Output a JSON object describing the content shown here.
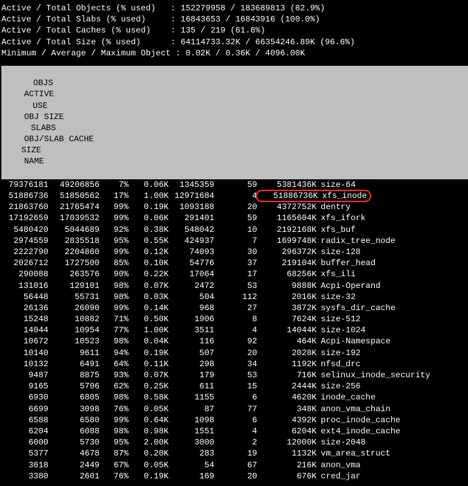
{
  "summary": [
    {
      "label": "Active / Total Objects (% used)   ",
      "sep": ": ",
      "value": "152279958 / 183689813 (82.9%)"
    },
    {
      "label": "Active / Total Slabs (% used)     ",
      "sep": ": ",
      "value": "16843653 / 16843916 (100.0%)"
    },
    {
      "label": "Active / Total Caches (% used)    ",
      "sep": ": ",
      "value": "135 / 219 (61.6%)"
    },
    {
      "label": "Active / Total Size (% used)      ",
      "sep": ": ",
      "value": "64114733.32K / 66354246.89K (96.6%)"
    },
    {
      "label": "Minimum / Average / Maximum Object",
      "sep": " : ",
      "value": "0.02K / 0.36K / 4096.00K"
    }
  ],
  "headers": {
    "objs": "OBJS",
    "active": "ACTIVE",
    "use": "USE",
    "objsz": "OBJ SIZE",
    "slabs": "SLABS",
    "objslb": "OBJ/SLAB CACHE",
    "cache": "SIZE",
    "name": "NAME"
  },
  "rows": [
    {
      "objs": "79376181",
      "active": "49206856",
      "use": "7%",
      "objsz": "0.06K",
      "slabs": "1345359",
      "objslb": "59",
      "cache": "5381436K",
      "name": "size-64"
    },
    {
      "objs": "51886736",
      "active": "51850562",
      "use": "17%",
      "objsz": "1.00K",
      "slabs": "12971684",
      "objslb": "4",
      "cache": "51886736K",
      "name": "xfs_inode",
      "hl": true
    },
    {
      "objs": "21863760",
      "active": "21765474",
      "use": "99%",
      "objsz": "0.19K",
      "slabs": "1093188",
      "objslb": "20",
      "cache": "4372752K",
      "name": "dentry"
    },
    {
      "objs": "17192659",
      "active": "17039532",
      "use": "99%",
      "objsz": "0.06K",
      "slabs": "291401",
      "objslb": "59",
      "cache": "1165604K",
      "name": "xfs_ifork"
    },
    {
      "objs": "5480420",
      "active": "5044689",
      "use": "92%",
      "objsz": "0.38K",
      "slabs": "548042",
      "objslb": "10",
      "cache": "2192168K",
      "name": "xfs_buf"
    },
    {
      "objs": "2974559",
      "active": "2835518",
      "use": "95%",
      "objsz": "0.55K",
      "slabs": "424937",
      "objslb": "7",
      "cache": "1699748K",
      "name": "radix_tree_node"
    },
    {
      "objs": "2222790",
      "active": "2204860",
      "use": "99%",
      "objsz": "0.12K",
      "slabs": "74093",
      "objslb": "30",
      "cache": "296372K",
      "name": "size-128"
    },
    {
      "objs": "2026712",
      "active": "1727500",
      "use": "85%",
      "objsz": "0.10K",
      "slabs": "54776",
      "objslb": "37",
      "cache": "219104K",
      "name": "buffer_head"
    },
    {
      "objs": "290088",
      "active": "263576",
      "use": "90%",
      "objsz": "0.22K",
      "slabs": "17064",
      "objslb": "17",
      "cache": "68256K",
      "name": "xfs_ili"
    },
    {
      "objs": "131016",
      "active": "129101",
      "use": "98%",
      "objsz": "0.07K",
      "slabs": "2472",
      "objslb": "53",
      "cache": "9888K",
      "name": "Acpi-Operand"
    },
    {
      "objs": "56448",
      "active": "55731",
      "use": "98%",
      "objsz": "0.03K",
      "slabs": "504",
      "objslb": "112",
      "cache": "2016K",
      "name": "size-32"
    },
    {
      "objs": "26136",
      "active": "26090",
      "use": "99%",
      "objsz": "0.14K",
      "slabs": "968",
      "objslb": "27",
      "cache": "3872K",
      "name": "sysfs_dir_cache"
    },
    {
      "objs": "15248",
      "active": "10882",
      "use": "71%",
      "objsz": "0.50K",
      "slabs": "1906",
      "objslb": "8",
      "cache": "7624K",
      "name": "size-512"
    },
    {
      "objs": "14044",
      "active": "10954",
      "use": "77%",
      "objsz": "1.00K",
      "slabs": "3511",
      "objslb": "4",
      "cache": "14044K",
      "name": "size-1024"
    },
    {
      "objs": "10672",
      "active": "10523",
      "use": "98%",
      "objsz": "0.04K",
      "slabs": "116",
      "objslb": "92",
      "cache": "464K",
      "name": "Acpi-Namespace"
    },
    {
      "objs": "10140",
      "active": "9611",
      "use": "94%",
      "objsz": "0.19K",
      "slabs": "507",
      "objslb": "20",
      "cache": "2028K",
      "name": "size-192"
    },
    {
      "objs": "10132",
      "active": "6491",
      "use": "64%",
      "objsz": "0.11K",
      "slabs": "298",
      "objslb": "34",
      "cache": "1192K",
      "name": "nfsd_drc"
    },
    {
      "objs": "9487",
      "active": "8875",
      "use": "93%",
      "objsz": "0.07K",
      "slabs": "179",
      "objslb": "53",
      "cache": "716K",
      "name": "selinux_inode_security"
    },
    {
      "objs": "9165",
      "active": "5706",
      "use": "62%",
      "objsz": "0.25K",
      "slabs": "611",
      "objslb": "15",
      "cache": "2444K",
      "name": "size-256"
    },
    {
      "objs": "6930",
      "active": "6805",
      "use": "98%",
      "objsz": "0.58K",
      "slabs": "1155",
      "objslb": "6",
      "cache": "4620K",
      "name": "inode_cache"
    },
    {
      "objs": "6699",
      "active": "3098",
      "use": "76%",
      "objsz": "0.05K",
      "slabs": "87",
      "objslb": "77",
      "cache": "348K",
      "name": "anon_vma_chain"
    },
    {
      "objs": "6588",
      "active": "6580",
      "use": "99%",
      "objsz": "0.64K",
      "slabs": "1098",
      "objslb": "6",
      "cache": "4392K",
      "name": "proc_inode_cache"
    },
    {
      "objs": "6204",
      "active": "6088",
      "use": "98%",
      "objsz": "0.98K",
      "slabs": "1551",
      "objslb": "4",
      "cache": "6204K",
      "name": "ext4_inode_cache"
    },
    {
      "objs": "6000",
      "active": "5730",
      "use": "95%",
      "objsz": "2.00K",
      "slabs": "3000",
      "objslb": "2",
      "cache": "12000K",
      "name": "size-2048"
    },
    {
      "objs": "5377",
      "active": "4678",
      "use": "87%",
      "objsz": "0.20K",
      "slabs": "283",
      "objslb": "19",
      "cache": "1132K",
      "name": "vm_area_struct"
    },
    {
      "objs": "3618",
      "active": "2449",
      "use": "67%",
      "objsz": "0.05K",
      "slabs": "54",
      "objslb": "67",
      "cache": "216K",
      "name": "anon_vma"
    },
    {
      "objs": "3380",
      "active": "2601",
      "use": "76%",
      "objsz": "0.19K",
      "slabs": "169",
      "objslb": "20",
      "cache": "676K",
      "name": "cred_jar"
    }
  ]
}
